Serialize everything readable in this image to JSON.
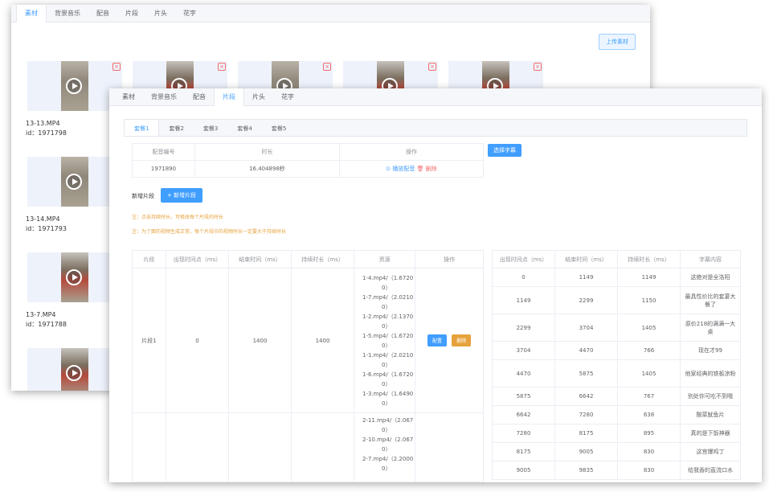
{
  "back": {
    "tabs": [
      "素材",
      "背景音乐",
      "配音",
      "片段",
      "片头",
      "花字"
    ],
    "upload_label": "上传素材",
    "items": [
      {
        "name": "13-13.MP4",
        "id": "id：1971798"
      },
      {
        "name": "13-14.MP4",
        "id": "id：1971793"
      },
      {
        "name": "13-7.MP4",
        "id": "id：1971788"
      }
    ]
  },
  "front": {
    "tabs": [
      "素材",
      "背景音乐",
      "配音",
      "片段",
      "片头",
      "花字"
    ],
    "subtabs": [
      "套餐1",
      "套餐2",
      "套餐3",
      "套餐4",
      "套餐5"
    ],
    "dub_table": {
      "headers": [
        "配音编号",
        "时长",
        "操作"
      ],
      "row": {
        "id": "1971890",
        "duration": "16.404898秒",
        "play": "⊙ 播放配音",
        "delete": "删除"
      }
    },
    "choose_subtitle": "选择字幕",
    "add_segment_label": "新增片段",
    "add_segment_button": "+ 新增片段",
    "note1": "注：点击持续时长，可修改每个片段的时长",
    "note2": "注：为了面的视频生成正常，每个片段中的视频时长一定要大于持续时长",
    "seg_table": {
      "headers": [
        "片段",
        "出现时间点（ms）",
        "结束时间（ms）",
        "持续时长（ms）",
        "资源",
        "操作"
      ],
      "rows": [
        {
          "name": "片段1",
          "start": "0",
          "end": "1400",
          "duration": "1400",
          "sources": [
            "1-4.mp4/（1.6720",
            "0）",
            "1-7.mp4/（2.0210",
            "0）",
            "1-2.mp4/（2.1370",
            "0）",
            "1-5.mp4/（1.6720",
            "0）",
            "1-1.mp4/（2.0210",
            "0）",
            "1-6.mp4/（1.6720",
            "0）",
            "1-3.mp4/（1.6490",
            "0）"
          ],
          "op1": "配置",
          "op2": "删除"
        },
        {
          "name": "",
          "start": "",
          "end": "",
          "duration": "",
          "sources": [
            "2-11.mp4/（2.067",
            "0）",
            "2-10.mp4/（2.067",
            "0）",
            "2-7.mp4/（2.2000",
            "0）"
          ],
          "op1": "",
          "op2": ""
        }
      ]
    },
    "sub_table": {
      "headers": [
        "出现时间点（ms）",
        "结束时间（ms）",
        "持续时长（ms）",
        "字幕内容"
      ],
      "rows": [
        [
          "0",
          "1149",
          "1149",
          "这绝对是全洛阳"
        ],
        [
          "1149",
          "2299",
          "1150",
          "最具性价比的套宴大餐了"
        ],
        [
          "2299",
          "3704",
          "1405",
          "原价218的满满一大桌"
        ],
        [
          "3704",
          "4470",
          "766",
          "现在才99"
        ],
        [
          "4470",
          "5875",
          "1405",
          "他家经典的铁板凉粉"
        ],
        [
          "5875",
          "6642",
          "767",
          "别处你可吃不到哦"
        ],
        [
          "6642",
          "7280",
          "638",
          "酸菜鱿鱼片"
        ],
        [
          "7280",
          "8175",
          "895",
          "真的是下饭神器"
        ],
        [
          "8175",
          "9005",
          "830",
          "这宫爆鸡丁"
        ],
        [
          "9005",
          "9835",
          "830",
          "给我香的直流口水"
        ]
      ]
    }
  }
}
